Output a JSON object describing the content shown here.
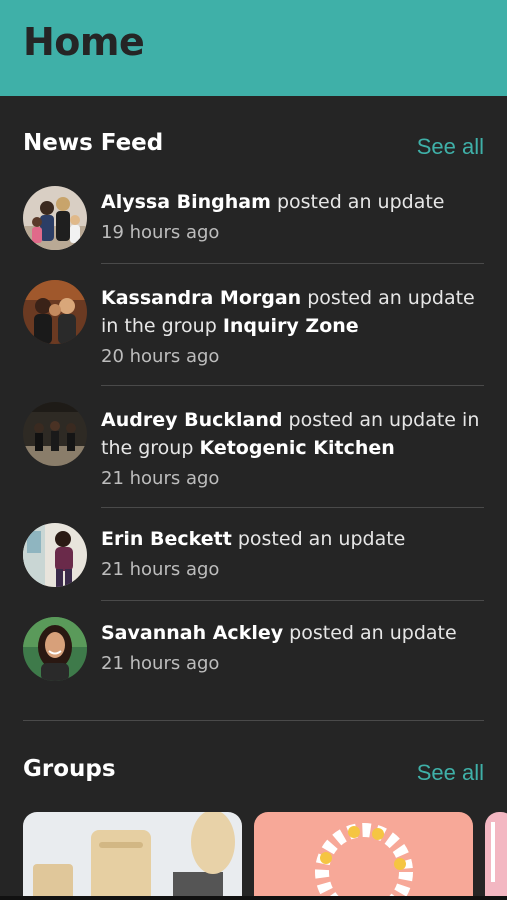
{
  "header": {
    "title": "Home"
  },
  "news_feed": {
    "title": "News Feed",
    "see_all": "See all",
    "items": [
      {
        "name": "Alyssa Bingham",
        "action": " posted an update",
        "group_prefix": "",
        "group": "",
        "time": "19 hours ago"
      },
      {
        "name": "Kassandra Morgan",
        "action": " posted an update in ",
        "group_prefix": "the group ",
        "group": "Inquiry Zone",
        "time": "20 hours ago"
      },
      {
        "name": "Audrey Buckland",
        "action": " posted an update in ",
        "group_prefix": "the group ",
        "group": "Ketogenic Kitchen",
        "time": "21 hours ago"
      },
      {
        "name": "Erin Beckett",
        "action": " posted an update",
        "group_prefix": "",
        "group": "",
        "time": "21 hours ago"
      },
      {
        "name": "Savannah Ackley",
        "action": " posted an update",
        "group_prefix": "",
        "group": "",
        "time": "21 hours ago"
      }
    ]
  },
  "groups": {
    "title": "Groups",
    "see_all": "See all"
  },
  "colors": {
    "accent": "#3fb0a8",
    "background": "#252525",
    "header_text": "#252525"
  }
}
